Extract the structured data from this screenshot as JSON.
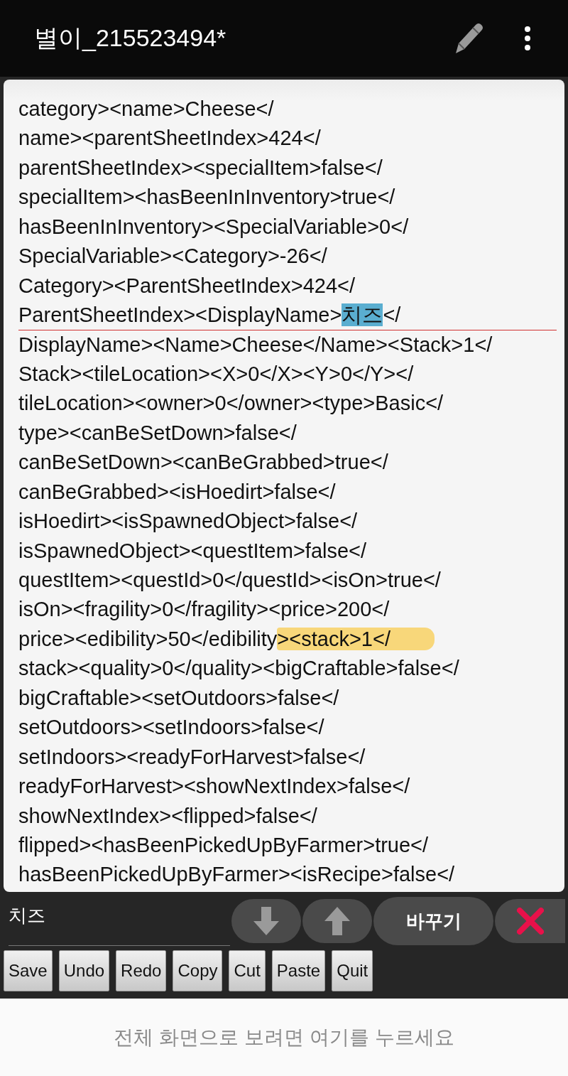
{
  "app_bar": {
    "title": "별이_215523494*"
  },
  "editor": {
    "lines": [
      {
        "parts": [
          {
            "kind": "plain",
            "text": "category><name>Cheese</"
          }
        ]
      },
      {
        "parts": [
          {
            "kind": "plain",
            "text": "name><parentSheetIndex>424</"
          }
        ]
      },
      {
        "parts": [
          {
            "kind": "plain",
            "text": "parentSheetIndex><specialItem>false</"
          }
        ]
      },
      {
        "parts": [
          {
            "kind": "plain",
            "text": "specialItem><hasBeenInInventory>true</"
          }
        ]
      },
      {
        "parts": [
          {
            "kind": "plain",
            "text": "hasBeenInInventory><SpecialVariable>0</"
          }
        ]
      },
      {
        "parts": [
          {
            "kind": "plain",
            "text": "SpecialVariable><Category>-26</"
          }
        ]
      },
      {
        "parts": [
          {
            "kind": "plain",
            "text": "Category><ParentSheetIndex>424</"
          }
        ]
      },
      {
        "cursor_line": true,
        "parts": [
          {
            "kind": "plain",
            "text": "ParentSheetIndex><DisplayName>"
          },
          {
            "kind": "selection",
            "text": "치즈"
          },
          {
            "kind": "plain",
            "text": "</"
          }
        ]
      },
      {
        "parts": [
          {
            "kind": "plain",
            "text": "DisplayName><Name>Cheese</Name><Stack>1</"
          }
        ]
      },
      {
        "parts": [
          {
            "kind": "plain",
            "text": "Stack><tileLocation><X>0</X><Y>0</Y></"
          }
        ]
      },
      {
        "parts": [
          {
            "kind": "plain",
            "text": "tileLocation><owner>0</owner><type>Basic</"
          }
        ]
      },
      {
        "parts": [
          {
            "kind": "plain",
            "text": "type><canBeSetDown>false</"
          }
        ]
      },
      {
        "parts": [
          {
            "kind": "plain",
            "text": "canBeSetDown><canBeGrabbed>true</"
          }
        ]
      },
      {
        "parts": [
          {
            "kind": "plain",
            "text": "canBeGrabbed><isHoedirt>false</"
          }
        ]
      },
      {
        "parts": [
          {
            "kind": "plain",
            "text": "isHoedirt><isSpawnedObject>false</"
          }
        ]
      },
      {
        "parts": [
          {
            "kind": "plain",
            "text": "isSpawnedObject><questItem>false</"
          }
        ]
      },
      {
        "parts": [
          {
            "kind": "plain",
            "text": "questItem><questId>0</questId><isOn>true</"
          }
        ]
      },
      {
        "parts": [
          {
            "kind": "plain",
            "text": "isOn><fragility>0</fragility><price>200</"
          }
        ]
      },
      {
        "parts": [
          {
            "kind": "plain",
            "text": "price><edibility>50</edibility"
          },
          {
            "kind": "marker",
            "text": "><stack>1</"
          }
        ]
      },
      {
        "parts": [
          {
            "kind": "plain",
            "text": "stack><quality>0</quality><bigCraftable>false</"
          }
        ]
      },
      {
        "parts": [
          {
            "kind": "plain",
            "text": "bigCraftable><setOutdoors>false</"
          }
        ]
      },
      {
        "parts": [
          {
            "kind": "plain",
            "text": "setOutdoors><setIndoors>false</"
          }
        ]
      },
      {
        "parts": [
          {
            "kind": "plain",
            "text": "setIndoors><readyForHarvest>false</"
          }
        ]
      },
      {
        "parts": [
          {
            "kind": "plain",
            "text": "readyForHarvest><showNextIndex>false</"
          }
        ]
      },
      {
        "parts": [
          {
            "kind": "plain",
            "text": "showNextIndex><flipped>false</"
          }
        ]
      },
      {
        "parts": [
          {
            "kind": "plain",
            "text": "flipped><hasBeenPickedUpByFarmer>true</"
          }
        ]
      },
      {
        "parts": [
          {
            "kind": "plain",
            "text": "hasBeenPickedUpByFarmer><isRecipe>false</"
          }
        ]
      }
    ]
  },
  "find_bar": {
    "value": "치즈",
    "replace_label": "바꾸기"
  },
  "toolbar": {
    "buttons": [
      "Save",
      "Undo",
      "Redo",
      "Copy",
      "Cut",
      "Paste",
      "Quit"
    ]
  },
  "fullscreen_hint": "전체 화면으로 보려면 여기를 누르세요"
}
